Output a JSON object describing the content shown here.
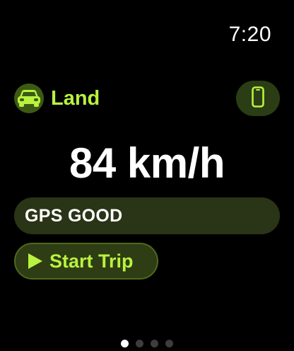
{
  "status_bar": {
    "time": "7:20"
  },
  "mode": {
    "icon": "car-icon",
    "label": "Land"
  },
  "phone_button": {
    "icon": "phone-icon"
  },
  "speed": {
    "display": "84 km/h"
  },
  "gps": {
    "status": "GPS GOOD"
  },
  "start_trip": {
    "icon": "play-icon",
    "label": "Start Trip"
  },
  "page_indicator": {
    "total": 4,
    "current": 1
  },
  "colors": {
    "background": "#000000",
    "accent": "#b9f23f",
    "accent_dark": "#2e3d14",
    "text": "#ffffff"
  }
}
